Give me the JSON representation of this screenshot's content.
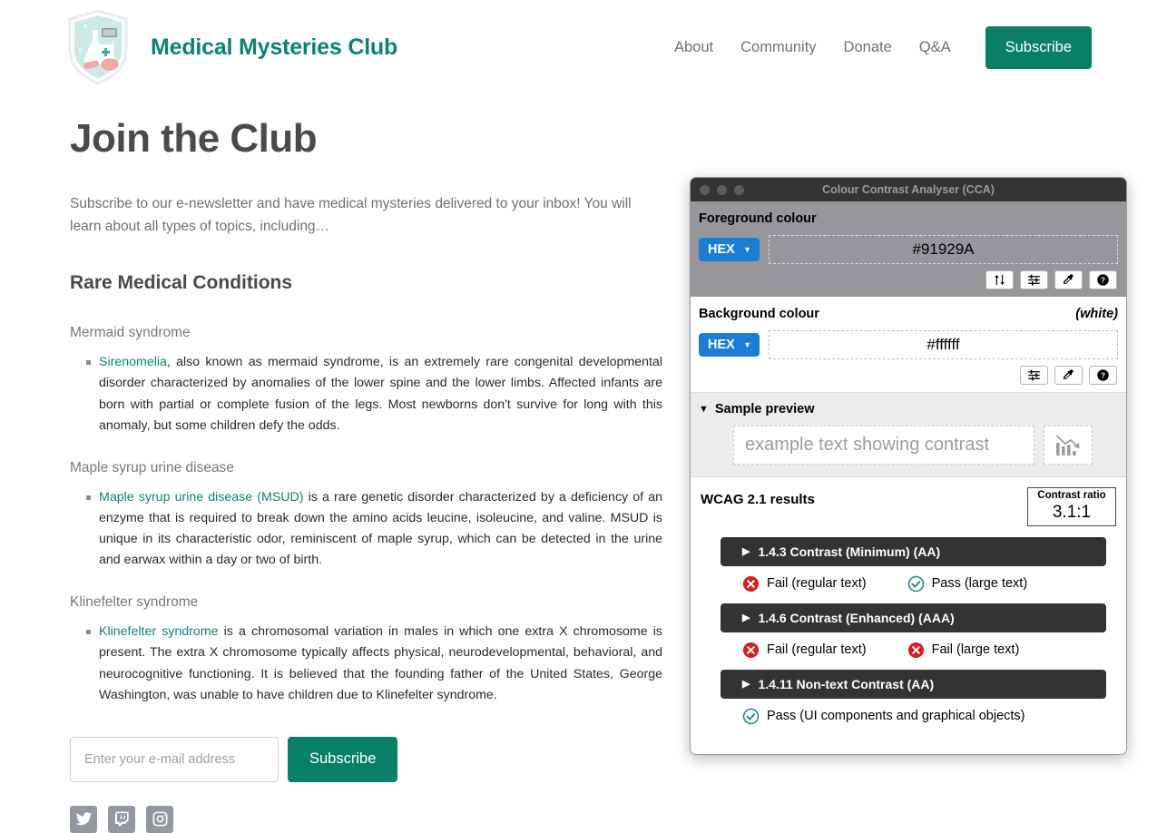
{
  "header": {
    "brand_title": "Medical Mysteries Club",
    "logo_icon": "shield-lab-logo",
    "nav": [
      {
        "label": "About",
        "name": "about"
      },
      {
        "label": "Community",
        "name": "community"
      },
      {
        "label": "Donate",
        "name": "donate"
      },
      {
        "label": "Q&A",
        "name": "qa"
      }
    ],
    "subscribe_label": "Subscribe",
    "accent_color": "#0a7f68",
    "brand_color": "#0e8272"
  },
  "main": {
    "page_title": "Join the Club",
    "intro": "Subscribe to our e-newsletter and have medical mysteries delivered to your inbox! You will learn about all types of topics, including…",
    "section_title": "Rare Medical Conditions",
    "conditions": [
      {
        "title": "Mermaid syndrome",
        "link_text": "Sirenomelia",
        "body": ", also known as mermaid syndrome, is an extremely rare congenital developmental disorder characterized by anomalies of the lower spine and the lower limbs. Affected infants are born with partial or complete fusion of the legs. Most newborns don't survive for long with this anomaly, but some children defy the odds."
      },
      {
        "title": "Maple syrup urine disease",
        "link_text": "Maple syrup urine disease (MSUD)",
        "body": " is a rare genetic disorder characterized by a deficiency of an enzyme that is required to break down the amino acids leucine, isoleucine, and valine. MSUD is unique in its characteristic odor, reminiscent of maple syrup, which can be detected in the urine and earwax within a day or two of birth."
      },
      {
        "title": "Klinefelter syndrome",
        "link_text": "Klinefelter syndrome",
        "body": " is a chromosomal variation in males in which one extra X chromosome is present. The extra X chromosome typically affects physical, neurodevelopmental, behavioral, and neurocognitive functioning. It is believed that the founding father of the United States, George Washington, was unable to have children due to Klinefelter syndrome."
      }
    ],
    "form": {
      "email_placeholder": "Enter your e-mail address",
      "email_value": "",
      "submit_label": "Subscribe"
    },
    "social": [
      {
        "name": "twitter-icon",
        "label": "Twitter"
      },
      {
        "name": "twitch-icon",
        "label": "Twitch"
      },
      {
        "name": "instagram-icon",
        "label": "Instagram"
      }
    ]
  },
  "cca": {
    "window_title": "Colour Contrast Analyser (CCA)",
    "foreground": {
      "label": "Foreground colour",
      "format": "HEX",
      "value": "#91929A",
      "buttons": [
        {
          "name": "swap-colours-icon",
          "title": "Swap colours"
        },
        {
          "name": "sliders-icon",
          "title": "Colour sliders"
        },
        {
          "name": "eyedropper-icon",
          "title": "Pick colour"
        },
        {
          "name": "help-icon",
          "title": "Help"
        }
      ]
    },
    "background": {
      "label": "Background colour",
      "note": "(white)",
      "format": "HEX",
      "value": "#ffffff",
      "buttons": [
        {
          "name": "sliders-icon",
          "title": "Colour sliders"
        },
        {
          "name": "eyedropper-icon",
          "title": "Pick colour"
        },
        {
          "name": "help-icon",
          "title": "Help"
        }
      ]
    },
    "sample": {
      "title": "Sample preview",
      "expanded": true,
      "text": "example text showing contrast",
      "graphic_icon": "declining-bar-chart-icon"
    },
    "results": {
      "title": "WCAG 2.1 results",
      "ratio_label": "Contrast ratio",
      "ratio_value": "3.1:1",
      "criteria": [
        {
          "name": "1.4.3 Contrast (Minimum) (AA)",
          "outcomes": [
            {
              "status": "fail",
              "label": "Fail (regular text)"
            },
            {
              "status": "pass",
              "label": "Pass (large text)"
            }
          ]
        },
        {
          "name": "1.4.6 Contrast (Enhanced) (AAA)",
          "outcomes": [
            {
              "status": "fail",
              "label": "Fail (regular text)"
            },
            {
              "status": "fail",
              "label": "Fail (large text)"
            }
          ]
        },
        {
          "name": "1.4.11 Non-text Contrast (AA)",
          "outcomes": [
            {
              "status": "pass",
              "label": "Pass (UI components and graphical objects)"
            }
          ]
        }
      ],
      "pass_color": "#0f8a7e",
      "fail_color": "#d81e20"
    }
  }
}
